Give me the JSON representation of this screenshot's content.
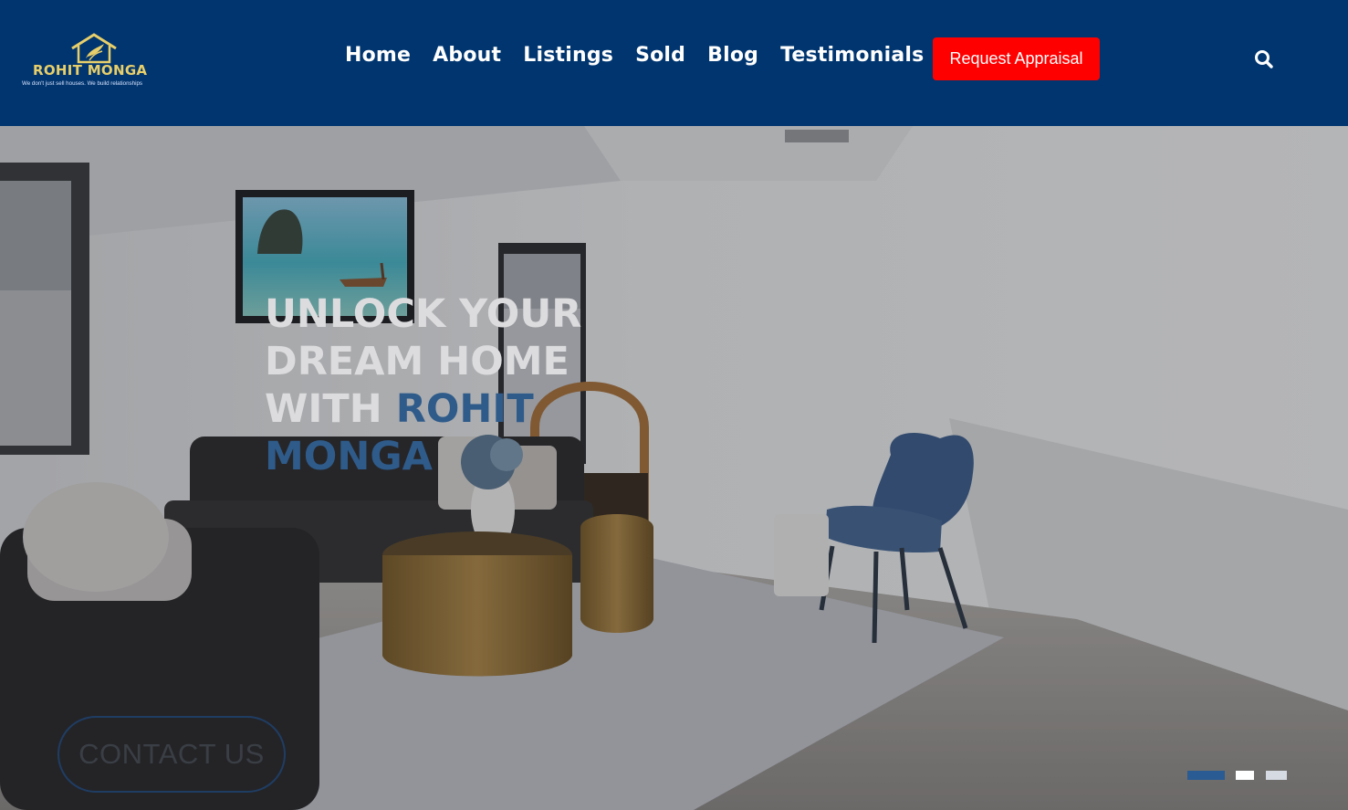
{
  "brand": {
    "name": "Rohit Monga",
    "tagline": "We don't just sell houses. We build relationships",
    "colors": {
      "navy": "#00356f",
      "gold": "#e8cf6a",
      "accent_red": "#fe0000",
      "highlight_blue": "#2f5b8a"
    }
  },
  "nav": {
    "items": [
      {
        "label": "Home"
      },
      {
        "label": "About"
      },
      {
        "label": "Listings"
      },
      {
        "label": "Sold"
      },
      {
        "label": "Blog"
      },
      {
        "label": "Testimonials"
      }
    ],
    "cta_label": "Request Appraisal",
    "search_icon": "search-icon"
  },
  "hero": {
    "title_line": "Unlock your dream home with",
    "title_highlight": "Rohit Monga",
    "contact_label": "CONTACT US",
    "slides": [
      {
        "active": true
      },
      {
        "active": false
      },
      {
        "active": false
      }
    ]
  }
}
